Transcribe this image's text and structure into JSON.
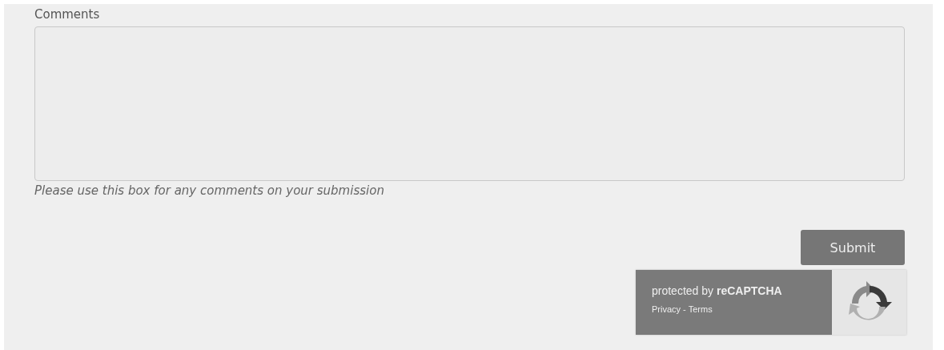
{
  "comments": {
    "label": "Comments",
    "hint": "Please use this box for any comments on your submission"
  },
  "submit_button": {
    "label": "Submit"
  },
  "recaptcha": {
    "text": "protected by **reCAPTCHA**",
    "links": [
      "Privacy",
      "Terms"
    ],
    "separator": "-"
  }
}
